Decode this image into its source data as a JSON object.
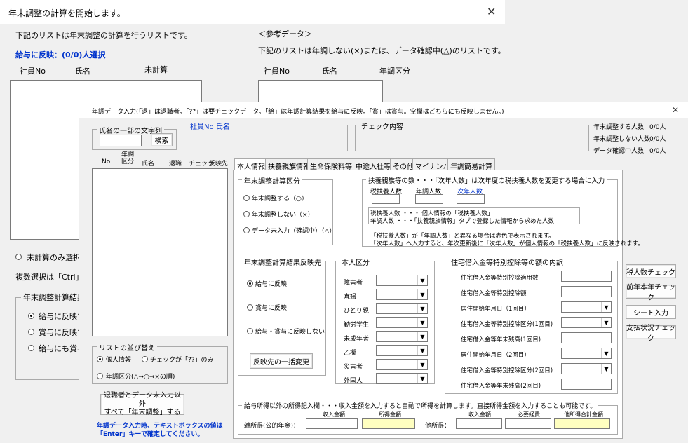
{
  "win1": {
    "title": "年末調整の計算を開始します。",
    "close": "✕",
    "left_desc": "下記のリストは年末調整の計算を行うリストです。",
    "selected": "給与に反映：(0/0)人選択",
    "left_cols": [
      "社員No",
      "氏名",
      "未計算"
    ],
    "ref_title": "＜参考データ＞",
    "right_desc": "下記のリストは年調しない(×)または、データ確認中(△)のリストです。",
    "right_cols": [
      "社員No",
      "氏名",
      "年調区分"
    ],
    "radio_uncalc": "未計算のみ選択",
    "multi_select": "複数選択は「Ctrl」キー",
    "group_title": "年末調整計算結果",
    "options": [
      "給与に反映する",
      "賞与に反映する",
      "給与にも賞与に"
    ]
  },
  "win2": {
    "hint": "年調データ入力(「退」は退職者。「??」は要チェックデータ。「給」は年調計算結果を給与に反映。「賞」は賞与。空欄はどちらにも反映しません。)",
    "close": "✕",
    "search_legend": "氏名の一部の文字列",
    "search_btn": "検索",
    "emp_legend": "社員No  氏名",
    "check_legend": "チェック内容",
    "stats": [
      {
        "label": "年末調整する人数",
        "value": "0/0人"
      },
      {
        "label": "年末調整しない人数",
        "value": "0/0人"
      },
      {
        "label": "データ確認中人数",
        "value": "0/0人"
      }
    ],
    "list_cols": [
      "No",
      "年調区分",
      "氏名",
      "退職",
      "チェック",
      "反映先"
    ],
    "sort_legend": "リストの並び替え",
    "sort_opts": [
      "個人情報",
      "チェックが「??」のみ",
      "年調区分(△→○→×の順)"
    ],
    "bulk_btn_1": "退職者とデータ未入力以外",
    "bulk_btn_2": "すべて「年末調整」する",
    "note_1": "年調データ入力時、テキストボックスの値は",
    "note_2": "「Enter」キーで確定してください。",
    "tabs": [
      "本人情報",
      "扶養親族情報",
      "生命保険料等",
      "中途入社等",
      "その他",
      "マイナンバー",
      "年調簡易計算"
    ],
    "nencho_legend": "年末調整計算区分",
    "nencho_opts": [
      "年末調整する（○）",
      "年末調整しない（×）",
      "データ未入力（確認中）（△）"
    ],
    "fuyo_legend": "扶養親族等の数・・・「次年人数」は次年度の税扶養人数を変更する場合に入力",
    "fuyo_cols": [
      "税扶養人数",
      "年調人数",
      "次年人数"
    ],
    "fuyo_desc_1": "税扶養人数 ・・・ 個人情報の「税扶養人数」",
    "fuyo_desc_2": "年調人数 ・・・「扶養親族情報」タブで登録した情報から求めた人数",
    "fuyo_note_1": "「税扶養人数」が「年調人数」と異なる場合は赤色で表示されます。",
    "fuyo_note_2": "「次年人数」へ入力すると、年次更新後に「次年人数」が個人情報の「税扶養人数」に反映されます。",
    "hanei_legend": "年末調整計算結果反映先",
    "hanei_opts": [
      "給与に反映",
      "賞与に反映",
      "給与・賞与に反映しない"
    ],
    "hanei_btn": "反映先の一括変更",
    "honnin_legend": "本人区分",
    "honnin_items": [
      "障害者",
      "寡婦",
      "ひとり親",
      "勤労学生",
      "未成年者",
      "乙欄",
      "災害者",
      "外国人"
    ],
    "jutaku_legend": "住宅借入金等特別控除等の額の内訳",
    "jutaku_items": [
      "住宅借入金等特別控除適用数",
      "住宅借入金等特別控除額",
      "居住開始年月日（1回目）",
      "住宅借入金等特別控除区分(1回目)",
      "住宅借入金等年末残高(1回目)",
      "居住開始年月日（2回目）",
      "住宅借入金等特別控除区分(2回目)",
      "住宅借入金等年末残高(2回目)"
    ],
    "side_btns": [
      "税人数チェック",
      "前年本年チェック",
      "シート入力",
      "支払状況チェック"
    ],
    "income_legend": "給与所得以外の所得記入欄・・・収入金額を入力すると自動で所得を計算します。直接所得金額を入力することも可能です。",
    "income_cols": [
      "収入金額",
      "所得金額",
      "収入金額",
      "必要経費",
      "他所得合計金額"
    ],
    "misc_label": "雑所得(公的年金)：",
    "other_label": "他所得："
  },
  "colors": {
    "window_bg": "#f0f0f0",
    "blue_text": "#0033cc",
    "yellow_field": "#ffffc0"
  }
}
